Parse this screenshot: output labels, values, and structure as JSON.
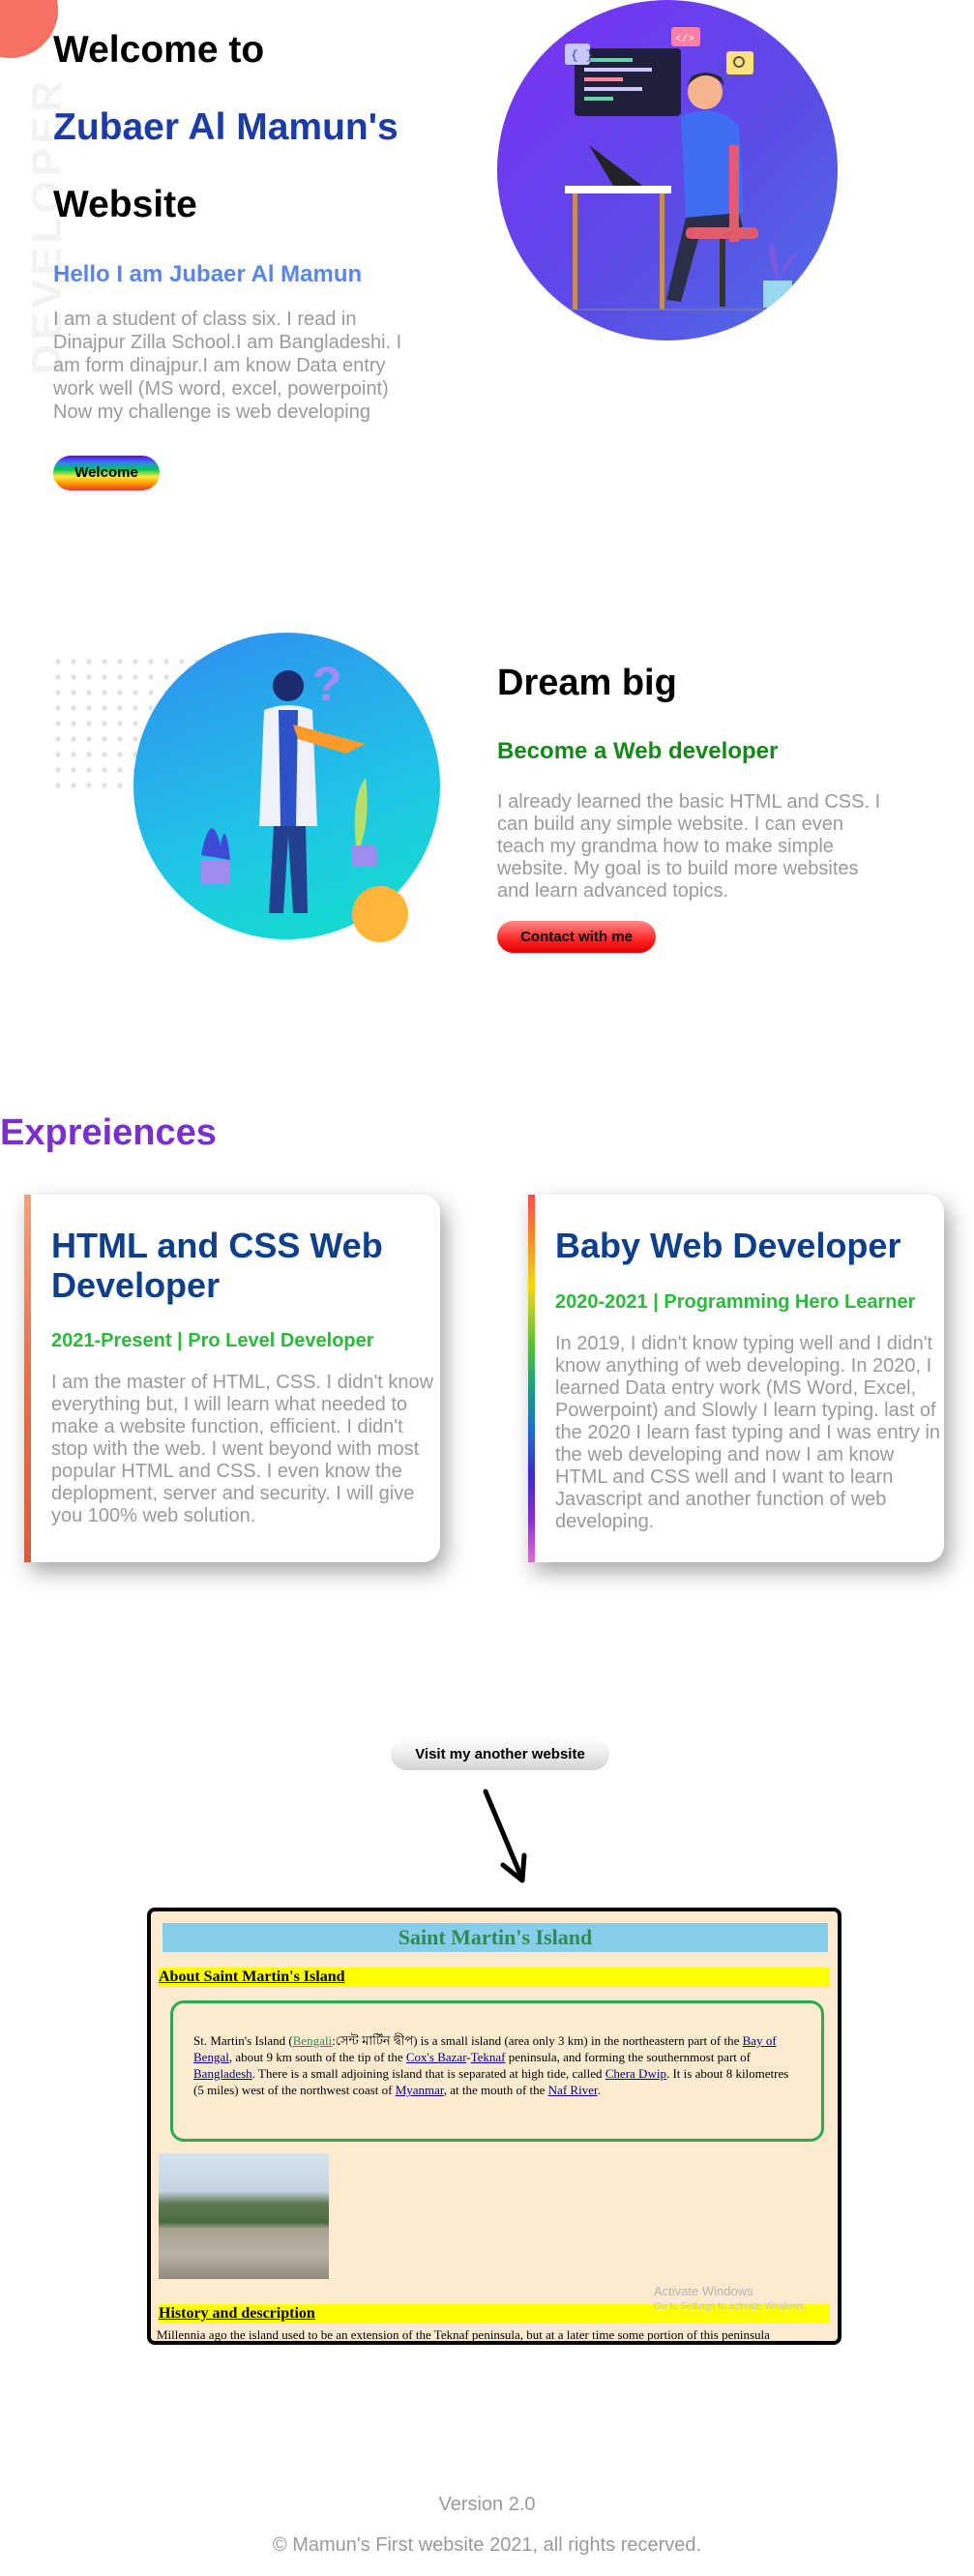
{
  "hero": {
    "vertical_text": "DEVELOPER",
    "title_line1": "Welcome to",
    "title_line2": "Zubaer Al Mamun's",
    "title_line3": "Website",
    "hello": "Hello I am Jubaer Al Mamun",
    "intro": "I am a student of class six. I read in Dinajpur Zilla School.I am Bangladeshi. I am form dinajpur.I am know Data entry work well (MS word, excel, powerpoint) Now my challenge is web developing",
    "button": "Welcome",
    "illustration_icons": [
      "braces-icon",
      "code-icon",
      "search-icon"
    ]
  },
  "dream": {
    "title": "Dream big",
    "subtitle": "Become a Web developer",
    "text": "I already learned the basic HTML and CSS. I can build any simple website. I can even teach my grandma how to make simple website. My goal is to build more websites and learn advanced topics.",
    "button": "Contact with me"
  },
  "experiences": {
    "heading": "Expreiences",
    "cards": [
      {
        "title": "HTML and CSS Web Developer",
        "subtitle": "2021-Present | Pro Level Developer",
        "text": "I am the master of HTML, CSS. I didn't know everything but, I will learn what needed to make a website function, efficient. I didn't stop with the web. I went beyond with most popular HTML and CSS. I even know the deplopment, server and security. I will give you 100% web solution."
      },
      {
        "title": "Baby Web Developer",
        "subtitle": "2020-2021 | Programming Hero Learner",
        "text": "In 2019, I didn't know typing well and I didn't know anything of web developing. In 2020, I learned Data entry work (MS Word, Excel, Powerpoint) and Slowly I learn typing. last of the 2020 I learn fast typing and I was entry in the web developing and now I am know HTML and CSS well and I want to learn Javascript and another function of web developing."
      }
    ]
  },
  "visit": {
    "button": "Visit my another website"
  },
  "preview": {
    "title": "Saint Martin's Island",
    "section1": "About Saint Martin's Island",
    "p_parts": {
      "t1": "St. Martin's Island (",
      "bengali": "Bengali",
      "t2": ":সেন্ট মার্টিন দ্বীপ) is a small island (area only 3 km) in the northeastern part of the ",
      "bay": "Bay of Bengal",
      "t3": ", about 9 km south of the tip of the ",
      "cox": "Cox's Bazar",
      "t4": "-",
      "teknaf": "Teknaf",
      "t5": " peninsula, and forming the southernmost part of ",
      "bangladesh": "Bangladesh",
      "t6": ". There is a small adjoining island that is separated at high tide, called ",
      "chera": "Chera Dwip",
      "t7": ". It is about 8 kilometres (5 miles) west of the northwest coast of ",
      "myanmar": "Myanmar",
      "t8": ", at the mouth of the ",
      "naf": "Naf River",
      "t9": "."
    },
    "section2": "History and description",
    "cut_text": "Millennia ago the island used to be an extension of the Teknaf peninsula, but at a later time some portion of this peninsula",
    "watermark1": "Activate Windows",
    "watermark2": "Go to Settings to activate Windows."
  },
  "footer": {
    "version": "Version 2.0",
    "copyright": "© Mamun's First website 2021, all rights recerved."
  }
}
